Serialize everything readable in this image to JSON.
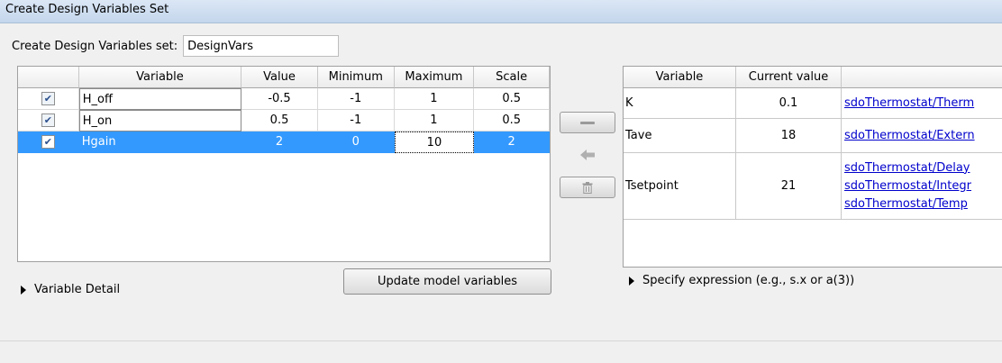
{
  "window": {
    "title": "Create Design Variables Set"
  },
  "name_field": {
    "label": "Create Design Variables set:",
    "value": "DesignVars"
  },
  "left_table": {
    "headers": [
      "",
      "Variable",
      "Value",
      "Minimum",
      "Maximum",
      "Scale"
    ],
    "rows": [
      {
        "checked": true,
        "variable": "H_off",
        "value": "-0.5",
        "minimum": "-1",
        "maximum": "1",
        "scale": "0.5"
      },
      {
        "checked": true,
        "variable": "H_on",
        "value": "0.5",
        "minimum": "-1",
        "maximum": "1",
        "scale": "0.5"
      },
      {
        "checked": true,
        "variable": "Hgain",
        "value": "2",
        "minimum": "0",
        "maximum": "10",
        "scale": "2"
      }
    ]
  },
  "buttons": {
    "update_model_variables": "Update model variables",
    "remove_icon": "minus-icon",
    "add_icon": "left-arrow-icon",
    "delete_icon": "trash-icon"
  },
  "right_table": {
    "headers": [
      "Variable",
      "Current value",
      ""
    ],
    "rows": [
      {
        "variable": "K",
        "current_value": "0.1",
        "links": [
          "sdoThermostat/Therm"
        ]
      },
      {
        "variable": "Tave",
        "current_value": "18",
        "links": [
          "sdoThermostat/Extern"
        ]
      },
      {
        "variable": "Tsetpoint",
        "current_value": "21",
        "links": [
          "sdoThermostat/Delay",
          "sdoThermostat/Integr",
          "sdoThermostat/Temp"
        ]
      }
    ]
  },
  "expanders": {
    "variable_detail": "Variable Detail",
    "specify_expression": "Specify expression (e.g., s.x or a(3))"
  },
  "colors": {
    "selection": "#3399ff",
    "title_bar": "#c9d9ee",
    "link": "#0000cc"
  }
}
